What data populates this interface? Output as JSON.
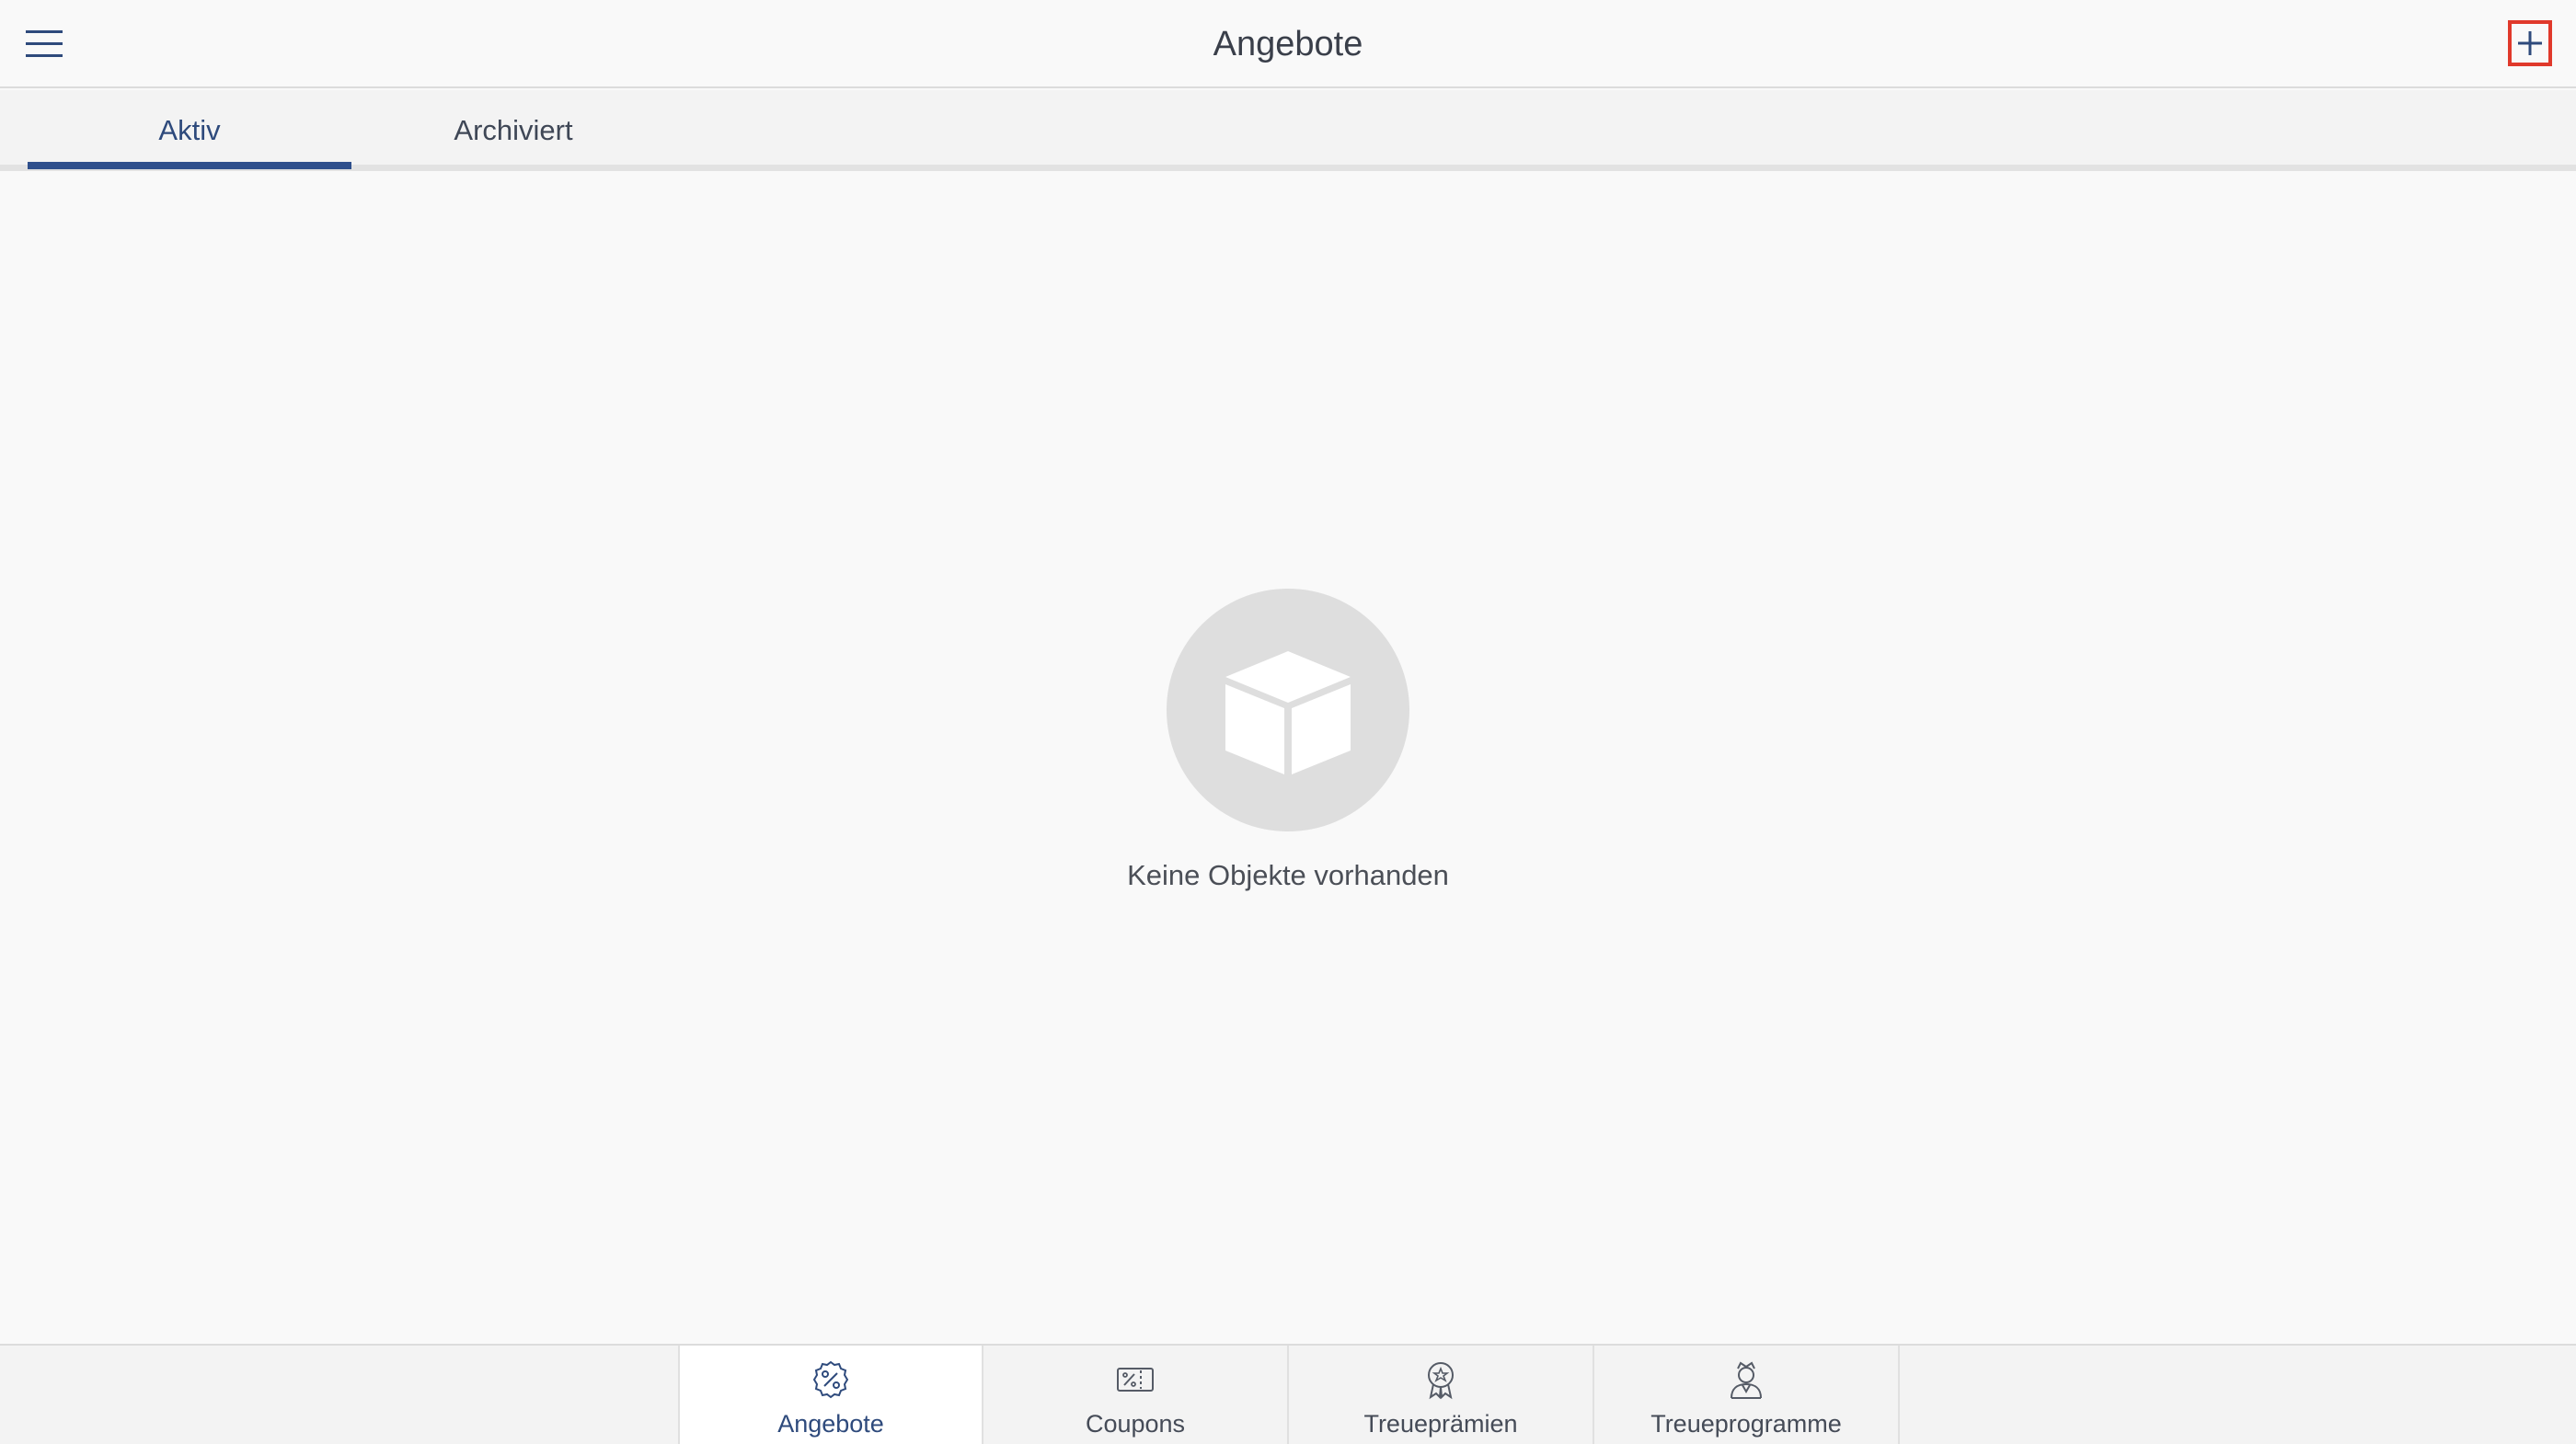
{
  "header": {
    "title": "Angebote",
    "menu_icon": "hamburger-menu-icon",
    "add_icon": "plus-icon"
  },
  "tabs": [
    {
      "label": "Aktiv",
      "active": true
    },
    {
      "label": "Archiviert",
      "active": false
    }
  ],
  "empty_state": {
    "icon": "box-icon",
    "message": "Keine Objekte vorhanden"
  },
  "bottom_nav": [
    {
      "label": "Angebote",
      "icon": "percent-badge-icon",
      "active": true
    },
    {
      "label": "Coupons",
      "icon": "coupon-icon",
      "active": false
    },
    {
      "label": "Treueprämien",
      "icon": "award-ribbon-icon",
      "active": false
    },
    {
      "label": "Treueprogramme",
      "icon": "loyalty-person-icon",
      "active": false
    }
  ],
  "colors": {
    "accent": "#2e4f8c",
    "highlight_border": "#e0392b",
    "background": "#f9f9f9"
  }
}
